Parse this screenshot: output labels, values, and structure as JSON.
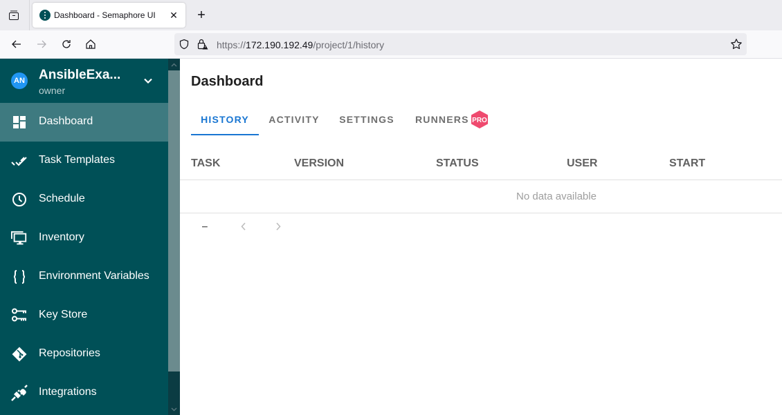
{
  "browser": {
    "tab": {
      "title": "Dashboard - Semaphore UI"
    },
    "url": {
      "scheme": "https://",
      "host": "172.190.192.49",
      "path": "/project/1/history"
    }
  },
  "sidebar": {
    "project": {
      "initials": "AN",
      "name": "AnsibleExa...",
      "role": "owner"
    },
    "items": [
      {
        "label": "Dashboard",
        "icon": "view-dashboard-icon",
        "active": true
      },
      {
        "label": "Task Templates",
        "icon": "check-all-icon",
        "active": false
      },
      {
        "label": "Schedule",
        "icon": "clock-icon",
        "active": false
      },
      {
        "label": "Inventory",
        "icon": "monitor-multiple-icon",
        "active": false
      },
      {
        "label": "Environment Variables",
        "icon": "code-braces-icon",
        "active": false
      },
      {
        "label": "Key Store",
        "icon": "key-change-icon",
        "active": false
      },
      {
        "label": "Repositories",
        "icon": "git-icon",
        "active": false
      },
      {
        "label": "Integrations",
        "icon": "connection-icon",
        "active": false
      }
    ]
  },
  "main": {
    "title": "Dashboard",
    "tabs": [
      {
        "label": "HISTORY",
        "active": true
      },
      {
        "label": "ACTIVITY",
        "active": false
      },
      {
        "label": "SETTINGS",
        "active": false
      },
      {
        "label": "RUNNERS",
        "active": false,
        "badge": "PRO"
      }
    ],
    "table": {
      "columns": [
        "TASK",
        "VERSION",
        "STATUS",
        "USER",
        "START"
      ],
      "empty_text": "No data available",
      "pagination_text": "–"
    }
  },
  "colors": {
    "sidebar_bg": "#005057",
    "sidebar_active": "#3e7a80",
    "accent": "#1976d2",
    "pro_badge": "#ef4a6f",
    "avatar": "#2196f3"
  }
}
